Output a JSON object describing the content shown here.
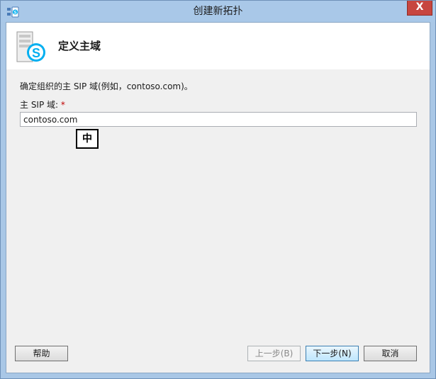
{
  "window": {
    "title": "创建新拓扑"
  },
  "titlebar": {
    "close_label": "X",
    "app_icon": "lync-topology-icon"
  },
  "header": {
    "title": "定义主域",
    "icon": "server-skype-icon"
  },
  "form": {
    "instruction": "确定组织的主 SIP 域(例如，contoso.com)。",
    "field_label": "主 SIP 域:",
    "required_marker": "*",
    "domain_value": "contoso.com"
  },
  "ime": {
    "mode_label": "中"
  },
  "buttons": {
    "help": "帮助",
    "prev": "上一步(B)",
    "next": "下一步(N)",
    "cancel": "取消"
  },
  "colors": {
    "titlebar": "#a9c8e8",
    "close_button": "#c7463f",
    "skype_blue": "#00aff0",
    "required_star": "#c00000"
  }
}
